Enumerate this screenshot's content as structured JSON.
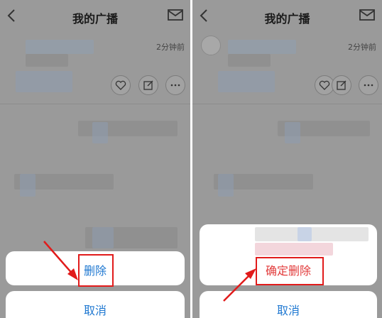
{
  "left": {
    "title": "我的广播",
    "timestamp": "2分钟前",
    "delete_label": "删除",
    "cancel_label": "取消"
  },
  "right": {
    "title": "我的广播",
    "timestamp": "2分钟前",
    "confirm_delete_label": "确定删除",
    "cancel_label": "取消"
  },
  "colors": {
    "overlay": "#9a9a9a",
    "sheet_text": "#1f78d1",
    "annotation": "#e11b1b"
  },
  "icons": [
    "back-arrow-icon",
    "mail-icon",
    "heart-icon",
    "edit-icon",
    "more-icon",
    "avatar"
  ]
}
